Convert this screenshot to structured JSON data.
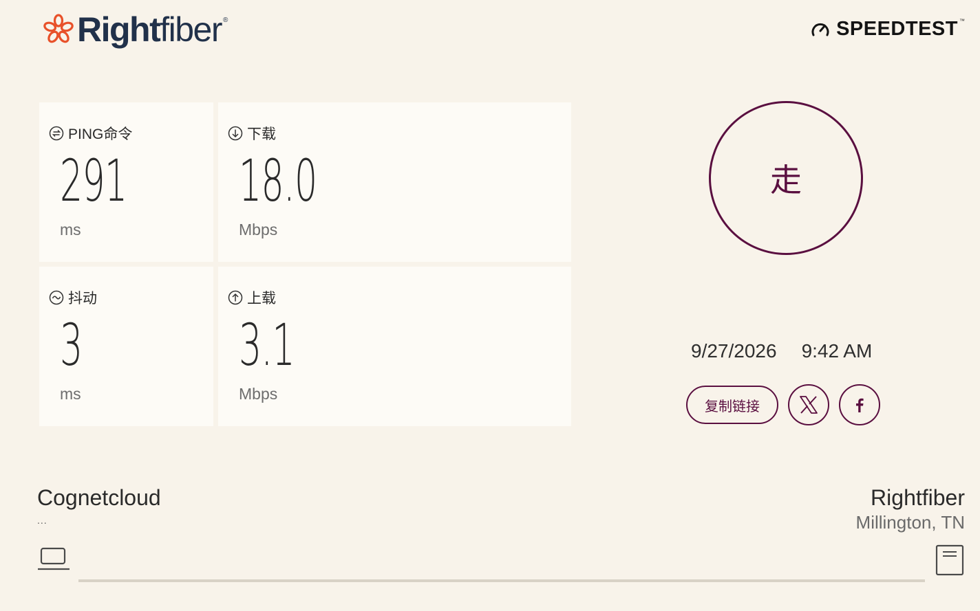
{
  "brand": {
    "name_bold": "Right",
    "name_light": "fiber",
    "reg_mark": "®"
  },
  "speedtest": {
    "label": "SPEEDTEST",
    "tm": "™"
  },
  "metrics": {
    "ping": {
      "title": "PING命令",
      "value": "291",
      "unit": "ms"
    },
    "download": {
      "title": "下载",
      "value": "18.0",
      "unit": "Mbps"
    },
    "jitter": {
      "title": "抖动",
      "value": "3",
      "unit": "ms"
    },
    "upload": {
      "title": "上载",
      "value": "3.1",
      "unit": "Mbps"
    }
  },
  "go_button": {
    "label": "走"
  },
  "result_time": {
    "date": "9/27/2026",
    "time": "9:42 AM"
  },
  "share": {
    "copy_link": "复制链接",
    "icons": [
      "x-icon",
      "facebook-icon"
    ]
  },
  "client": {
    "isp": "Cognetcloud",
    "ip": "..."
  },
  "server": {
    "name": "Rightfiber",
    "location": "Millington, TN"
  },
  "colors": {
    "accent": "#5a0f40",
    "background": "#f8f3ea",
    "card": "#fdfbf6",
    "logo_orange": "#e8512a",
    "logo_navy": "#21314a"
  },
  "progress": {
    "fraction": 0
  }
}
